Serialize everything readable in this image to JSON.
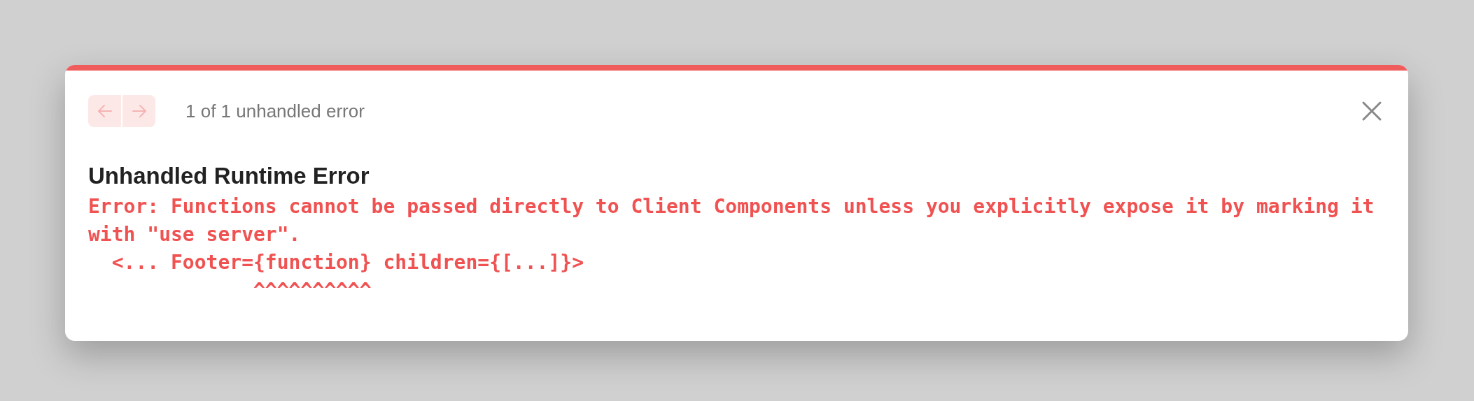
{
  "nav": {
    "previous": {
      "disabled": true
    },
    "next": {
      "disabled": true
    },
    "counter": "1 of 1 unhandled error"
  },
  "title": "Unhandled Runtime Error",
  "message_lines": [
    "Error: Functions cannot be passed directly to Client Components unless you explicitly expose it by marking it",
    "with \"use server\".",
    "  <... Footer={function} children={[...]}>",
    "              ^^^^^^^^^^"
  ]
}
